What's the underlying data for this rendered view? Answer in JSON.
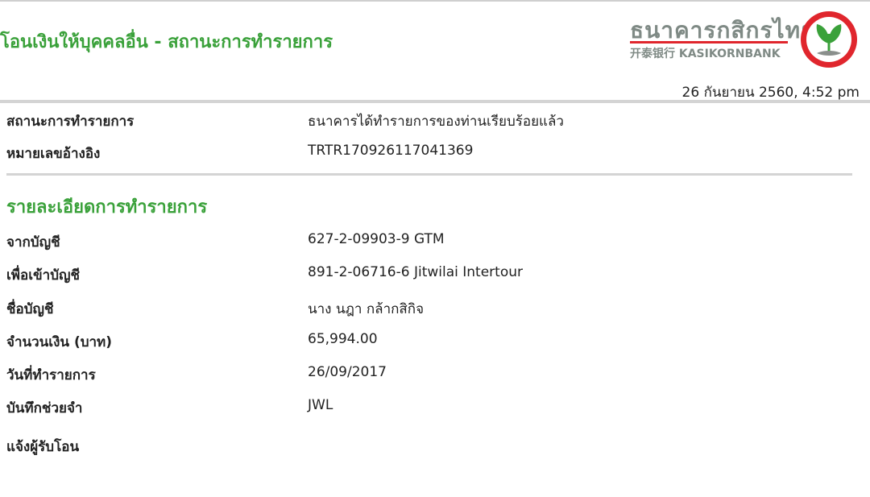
{
  "header": {
    "title": "โอนเงินให้บุคคลอื่น - สถานะการทำรายการ",
    "timestamp": "26 กันยายน 2560, 4:52 pm"
  },
  "logo": {
    "thai_name": "ธนาคารกสิกรไทย",
    "english_name": "开泰银行 KASIKORNBANK",
    "emblem_icon": "kasikorn-leaf-icon",
    "colors": {
      "emblem_ring": "#e0262d",
      "leaf": "#3aa13a",
      "text": "#7f8a85"
    }
  },
  "status": {
    "rows": [
      {
        "label": "สถานะการทำรายการ",
        "value": "ธนาคารได้ทำรายการของท่านเรียบร้อยแล้ว"
      },
      {
        "label": "หมายเลขอ้างอิง",
        "value": "TRTR170926117041369"
      }
    ]
  },
  "details": {
    "title": "รายละเอียดการทำรายการ",
    "rows": [
      {
        "label": "จากบัญชี",
        "value": "627-2-09903-9 GTM"
      },
      {
        "label": "เพื่อเข้าบัญชี",
        "value": "891-2-06716-6 Jitwilai Intertour"
      },
      {
        "label": "ชื่อบัญชี",
        "value": "นาง นฎา กล้ากสิกิจ"
      },
      {
        "label": "จำนวนเงิน (บาท)",
        "value": "65,994.00"
      },
      {
        "label": "วันที่ทำรายการ",
        "value": "26/09/2017"
      },
      {
        "label": "บันทึกช่วยจำ",
        "value": "JWL"
      },
      {
        "label": "แจ้งผู้รับโอน",
        "value": ""
      }
    ]
  },
  "theme": {
    "accent_green": "#3aa13a",
    "divider": "#d4d4d4"
  }
}
